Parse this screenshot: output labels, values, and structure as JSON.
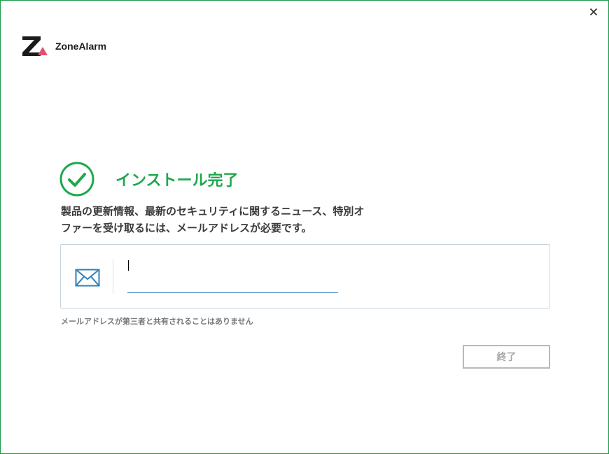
{
  "window": {
    "accent_color": "#1fa84e",
    "border_color": "#1a9a4a"
  },
  "brand": {
    "name": "ZoneAlarm",
    "logo_icon": "zonealarm-logo",
    "logo_accent": "#e2526d"
  },
  "header": {
    "close_icon": "close-icon"
  },
  "success": {
    "icon": "check-circle-icon",
    "title": "インストール完了"
  },
  "description": {
    "line1": "製品の更新情報、最新のセキュリティに関するニュース、特別オ",
    "line2": "ファーを受け取るには、メールアドレスが必要です。"
  },
  "email": {
    "icon": "mail-icon",
    "value": "",
    "placeholder": ""
  },
  "privacy_note": "メールアドレスが第三者と共有されることはありません",
  "actions": {
    "finish_label": "終了"
  }
}
